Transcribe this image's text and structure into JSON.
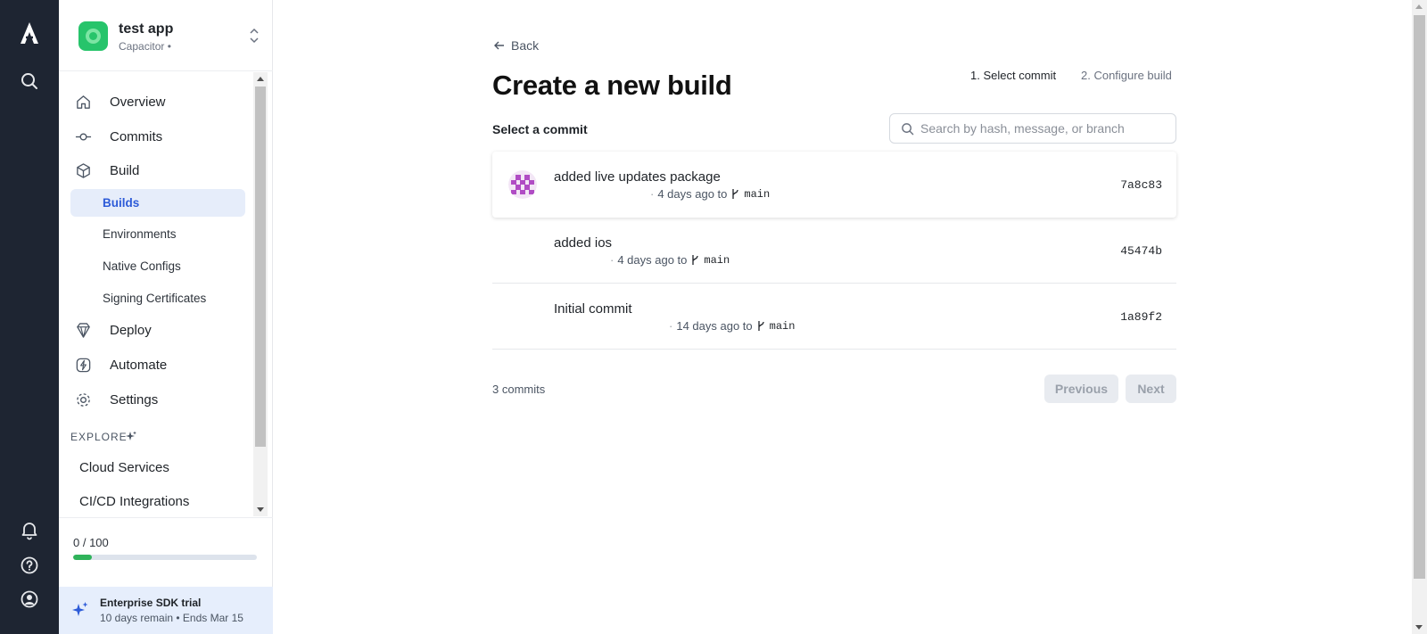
{
  "rail": {
    "icons": [
      "logo-icon",
      "search-icon",
      "bell-icon",
      "help-icon",
      "user-icon"
    ]
  },
  "app": {
    "name": "test app",
    "subtitle": "Capacitor •"
  },
  "nav": {
    "overview": "Overview",
    "commits": "Commits",
    "build": "Build",
    "builds": "Builds",
    "environments": "Environments",
    "native_configs": "Native Configs",
    "signing_certificates": "Signing Certificates",
    "deploy": "Deploy",
    "automate": "Automate",
    "settings": "Settings",
    "explore": "EXPLORE",
    "cloud_services": "Cloud Services",
    "cicd": "CI/CD Integrations"
  },
  "usage": {
    "text": "0 / 100",
    "fraction": 0.1
  },
  "trial": {
    "title": "Enterprise SDK trial",
    "detail": "10 days remain • Ends Mar 15"
  },
  "main": {
    "back": "Back",
    "title": "Create a new build",
    "step1": "1. Select commit",
    "step2": "2. Configure build",
    "select_label": "Select a commit",
    "search_placeholder": "Search by hash, message, or branch",
    "count": "3 commits",
    "prev": "Previous",
    "next": "Next"
  },
  "commits": [
    {
      "message": "added live updates package",
      "time": "4 days ago to",
      "branch": "main",
      "hash": "7a8c83"
    },
    {
      "message": "added ios",
      "time": "4 days ago to",
      "branch": "main",
      "hash": "45474b"
    },
    {
      "message": "Initial commit",
      "time": "14 days ago to",
      "branch": "main",
      "hash": "1a89f2"
    }
  ],
  "colors": {
    "rail": "#1e2532",
    "accent": "#2d5bd8",
    "active_bg": "#e6edfa",
    "app_icon": "#27c46b",
    "progress": "#2fb35a",
    "avatar": "#b04cc4"
  }
}
